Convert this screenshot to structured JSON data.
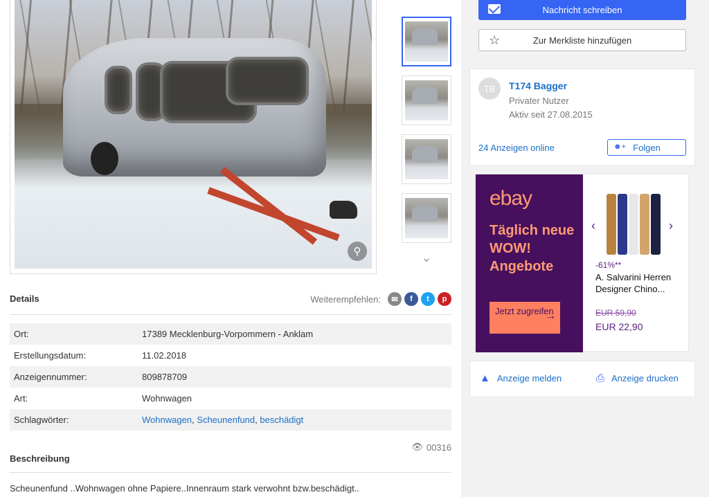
{
  "gallery": {
    "zoom_icon": "magnifier-icon",
    "thumb_up_icon": "chevron-up-icon",
    "thumb_down_icon": "chevron-down-icon",
    "thumbnails": [
      "thumb-1",
      "thumb-2",
      "thumb-3",
      "thumb-4"
    ]
  },
  "details": {
    "heading": "Details",
    "share_label": "Weiterempfehlen:",
    "rows": [
      {
        "key": "Ort:",
        "value": "17389 Mecklenburg-Vorpommern - Anklam"
      },
      {
        "key": "Erstellungsdatum:",
        "value": "11.02.2018"
      },
      {
        "key": "Anzeigennummer:",
        "value": "809878709"
      },
      {
        "key": "Art:",
        "value": "Wohnwagen"
      },
      {
        "key": "Schlagwörter:",
        "tags": [
          "Wohnwagen",
          "Scheunenfund",
          "beschädigt"
        ]
      }
    ],
    "views": "00316"
  },
  "description": {
    "heading": "Beschreibung",
    "text": "Scheunenfund ..Wohnwagen ohne Papiere..Innenraum stark verwohnt bzw.beschädigt.."
  },
  "contact": {
    "message_button": "Nachricht schreiben",
    "watchlist_button": "Zur Merkliste hinzufügen"
  },
  "seller": {
    "initials": "TB",
    "name": "T174 Bagger",
    "type": "Privater Nutzer",
    "active_since": "Aktiv seit 27.08.2015",
    "ads_online": "24 Anzeigen online",
    "follow_button": "Folgen"
  },
  "ad": {
    "logo": "ebay",
    "headline": "Täglich neue WOW! Angebote",
    "cta": "Jetzt zugreifen",
    "discount": "-61%**",
    "product_title": "A. Salvarini Herren Designer Chino...",
    "old_price": "EUR 59,90",
    "new_price": "EUR 22,90"
  },
  "actions": {
    "report": "Anzeige melden",
    "print": "Anzeige drucken"
  },
  "colors": {
    "primary": "#3665f3",
    "link": "#1a6fc9",
    "ad_bg": "#46105e",
    "ad_accent": "#ff9a75"
  }
}
